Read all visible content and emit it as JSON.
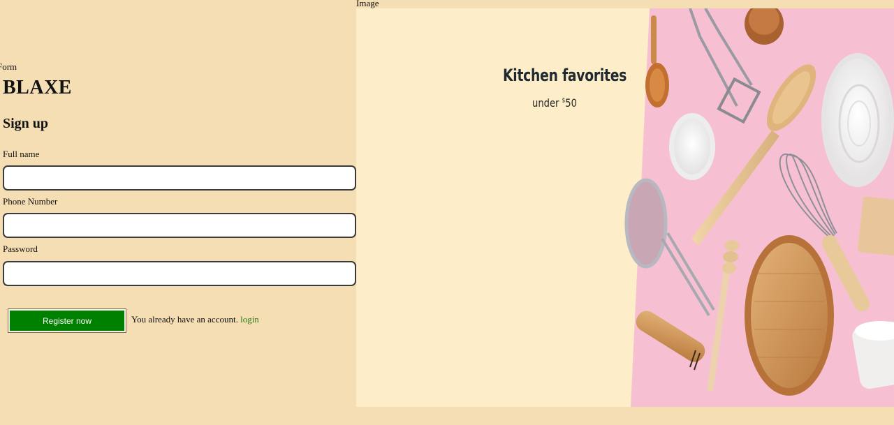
{
  "captions": {
    "form": "Form",
    "image": "Image"
  },
  "brand": "BLAXE",
  "heading": "Sign up",
  "fields": [
    {
      "label": "Full name",
      "value": "",
      "placeholder": ""
    },
    {
      "label": "Phone Number",
      "value": "",
      "placeholder": ""
    },
    {
      "label": "Password",
      "value": "",
      "placeholder": ""
    }
  ],
  "register_button": "Register now",
  "account_prompt": "You already have an account.",
  "login_link": "login",
  "promo": {
    "title": "Kitchen favorites",
    "subtitle_prefix": "under ",
    "currency": "$",
    "amount": "50"
  },
  "colors": {
    "page_background": "#f5deb3",
    "image_background": "#fdedc8",
    "photo_background": "#f7c0d2",
    "button": "#008000",
    "link": "#2e7d15"
  }
}
